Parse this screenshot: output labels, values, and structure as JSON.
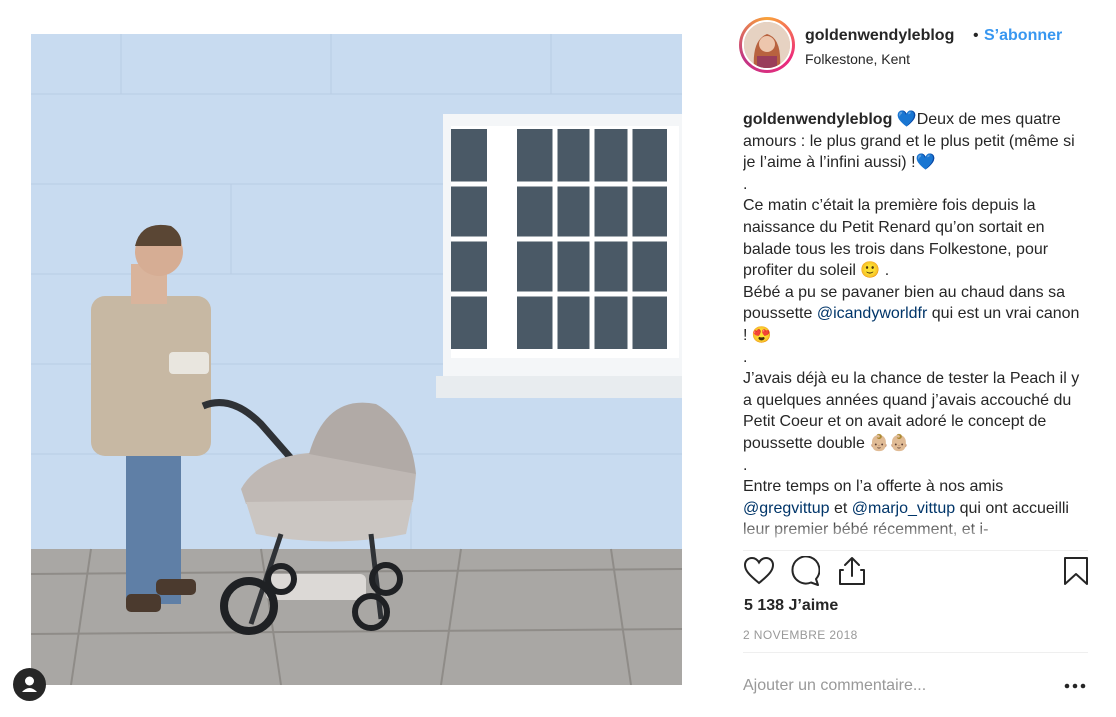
{
  "post": {
    "username": "goldenwendyleblog",
    "separator": "•",
    "follow_label": "S’abonner",
    "location": "Folkestone, Kent",
    "photo_alt": "Homme avec une poussette devant un mur bleu"
  },
  "caption": {
    "username": "goldenwendyleblog",
    "line1": " 💙Deux de mes quatre amours : le plus grand et le plus petit (même si je l’aime à l’infini aussi) !💙",
    "sep1": ".",
    "para2": "Ce matin c’était la première fois depuis la naissance du Petit Renard qu’on sortait en balade tous les trois dans Folkestone, pour profiter du soleil 🙂 .",
    "para3_before": "Bébé a pu se pavaner bien au chaud dans sa poussette ",
    "mention1": "@icandyworldfr",
    "para3_after": " qui est un vrai canon ! 😍",
    "sep2": ".",
    "para4": "J’avais déjà eu la chance de tester la Peach il y a quelques années quand j’avais accouché du Petit Coeur et on avait adoré le concept de poussette double 👶🏼👶🏼",
    "sep3": ".",
    "para5_before": "Entre temps on l’a offerte à nos amis ",
    "mention2": "@gregvittup",
    "para5_mid": " et ",
    "mention3": "@marjo_vittup",
    "para5_after": " qui ont accueilli leur premier bébé récemment, et i-"
  },
  "actions": {
    "like_icon": "heart-icon",
    "comment_icon": "comment-icon",
    "share_icon": "share-icon",
    "save_icon": "bookmark-icon"
  },
  "stats": {
    "likes": "5 138 J’aime",
    "date": "2 NOVEMBRE 2018"
  },
  "comment": {
    "placeholder": "Ajouter un commentaire..."
  },
  "colors": {
    "follow": "#3897f0",
    "mention": "#003569",
    "wall": "#c9dcf0"
  }
}
